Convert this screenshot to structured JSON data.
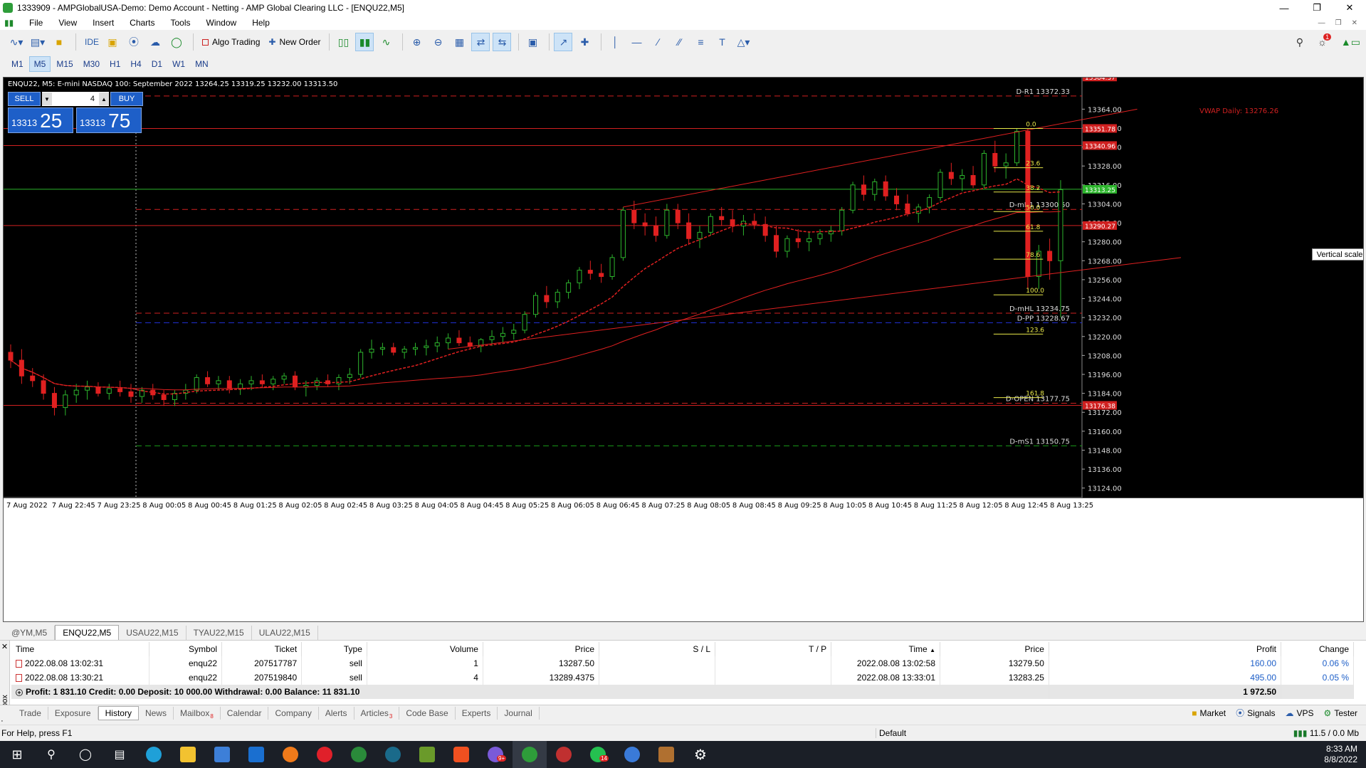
{
  "window": {
    "title": "1333909 - AMPGlobalUSA-Demo: Demo Account - Netting - AMP Global Clearing LLC - [ENQU22,M5]"
  },
  "menu": [
    "File",
    "View",
    "Insert",
    "Charts",
    "Tools",
    "Window",
    "Help"
  ],
  "toolbar": {
    "ide_label": "IDE",
    "algo_label": "Algo Trading",
    "new_order_label": "New Order",
    "notification_count": "1"
  },
  "timeframes": [
    "M1",
    "M5",
    "M15",
    "M30",
    "H1",
    "H4",
    "D1",
    "W1",
    "MN"
  ],
  "active_timeframe": "M5",
  "chart": {
    "header": "ENQU22, M5:  E-mini NASDAQ 100: September 2022   13264.25 13319.25 13232.00 13313.50",
    "sell_label": "SELL",
    "buy_label": "BUY",
    "volume": "4",
    "sell_small": "13313",
    "sell_big": "25",
    "buy_small": "13313",
    "buy_big": "75",
    "vertical_scale_tip": "Vertical scale",
    "vwap_label": "VWAP Daily: 13276.26",
    "colors": {
      "background": "#000000",
      "bull": "#2db52d",
      "bear": "#e02020",
      "level": "#d02020",
      "fib": "#e8e84a",
      "pivot_pp": "#2030d0",
      "ms1": "#1a9a1a"
    }
  },
  "chart_data": {
    "type": "candlestick",
    "symbol": "ENQU22",
    "timeframe": "M5",
    "ylim": [
      13118,
      13384
    ],
    "y_ticks": [
      13364.0,
      13352.0,
      13340.0,
      13328.0,
      13316.0,
      13304.0,
      13292.0,
      13280.0,
      13268.0,
      13256.0,
      13244.0,
      13232.0,
      13220.0,
      13208.0,
      13196.0,
      13184.0,
      13172.0,
      13160.0,
      13148.0,
      13136.0,
      13124.0
    ],
    "y_tick_labels": [
      "13364.00",
      "13352.00",
      "13340.00",
      "13328.00",
      "13316.00",
      "13304.00",
      "13292.00",
      "13280.00",
      "13268.00",
      "13256.00",
      "13244.00",
      "13232.00",
      "13220.00",
      "13208.00",
      "13196.00",
      "13184.00",
      "13172.00",
      "13160.00",
      "13148.00",
      "13136.00",
      "13124.00"
    ],
    "price_badges": [
      {
        "price": 13384.37,
        "label": "13384.37"
      },
      {
        "price": 13351.78,
        "label": "13351.78"
      },
      {
        "price": 13340.96,
        "label": "13340.96"
      },
      {
        "price": 13313.25,
        "label": "13313.25"
      },
      {
        "price": 13290.27,
        "label": "13290.27"
      },
      {
        "price": 13176.38,
        "label": "13176.38"
      }
    ],
    "x_tick_labels": [
      "7 Aug 2022",
      "7 Aug 22:45",
      "7 Aug 23:25",
      "8 Aug 00:05",
      "8 Aug 00:45",
      "8 Aug 01:25",
      "8 Aug 02:05",
      "8 Aug 02:45",
      "8 Aug 03:25",
      "8 Aug 04:05",
      "8 Aug 04:45",
      "8 Aug 05:25",
      "8 Aug 06:05",
      "8 Aug 06:45",
      "8 Aug 07:25",
      "8 Aug 08:05",
      "8 Aug 08:45",
      "8 Aug 09:25",
      "8 Aug 10:05",
      "8 Aug 10:45",
      "8 Aug 11:25",
      "8 Aug 12:05",
      "8 Aug 12:45",
      "8 Aug 13:25"
    ],
    "levels": [
      {
        "name": "D-R1",
        "price": 13372.33,
        "label": "D-R1 13372.33",
        "style": "dash"
      },
      {
        "name": "D-mR1",
        "price": 13300.5,
        "label": "D-mR1 13300.50",
        "style": "dash"
      },
      {
        "name": "D-mHL",
        "price": 13234.75,
        "label": "D-mHL 13234.75",
        "style": "dash"
      },
      {
        "name": "D-PP",
        "price": 13228.67,
        "label": "D-PP 13228.67",
        "style": "dash"
      },
      {
        "name": "D-OPEN",
        "price": 13177.75,
        "label": "D-OPEN 13177.75",
        "style": "dash"
      },
      {
        "name": "D-mS1",
        "price": 13150.75,
        "label": "D-mS1 13150.75",
        "style": "dash"
      }
    ],
    "fibonacci": [
      {
        "level": "0.0",
        "price": 13351.78
      },
      {
        "level": "23.6",
        "price": 13326.9
      },
      {
        "level": "38.2",
        "price": 13311.5
      },
      {
        "level": "50.0",
        "price": 13299.1
      },
      {
        "level": "61.8",
        "price": 13286.7
      },
      {
        "level": "78.6",
        "price": 13269.0
      },
      {
        "level": "100.0",
        "price": 13246.4
      },
      {
        "level": "123.6",
        "price": 13221.5
      },
      {
        "level": "161.8",
        "price": 13181.3
      }
    ],
    "candles": [
      [
        13210,
        13215,
        13200,
        13205
      ],
      [
        13205,
        13212,
        13190,
        13195
      ],
      [
        13195,
        13200,
        13188,
        13192
      ],
      [
        13192,
        13196,
        13180,
        13184
      ],
      [
        13184,
        13188,
        13170,
        13175
      ],
      [
        13175,
        13186,
        13170,
        13183
      ],
      [
        13183,
        13190,
        13178,
        13186
      ],
      [
        13186,
        13192,
        13180,
        13188
      ],
      [
        13188,
        13191,
        13182,
        13184
      ],
      [
        13184,
        13190,
        13180,
        13187
      ],
      [
        13187,
        13192,
        13182,
        13185
      ],
      [
        13185,
        13190,
        13178,
        13182
      ],
      [
        13182,
        13188,
        13178,
        13186
      ],
      [
        13186,
        13190,
        13180,
        13183
      ],
      [
        13183,
        13186,
        13176,
        13180
      ],
      [
        13180,
        13186,
        13176,
        13184
      ],
      [
        13184,
        13190,
        13180,
        13186
      ],
      [
        13186,
        13196,
        13184,
        13194
      ],
      [
        13194,
        13198,
        13188,
        13190
      ],
      [
        13190,
        13195,
        13186,
        13192
      ],
      [
        13192,
        13195,
        13184,
        13187
      ],
      [
        13187,
        13193,
        13183,
        13190
      ],
      [
        13190,
        13195,
        13186,
        13192
      ],
      [
        13192,
        13196,
        13188,
        13190
      ],
      [
        13190,
        13195,
        13186,
        13193
      ],
      [
        13193,
        13197,
        13190,
        13195
      ],
      [
        13195,
        13198,
        13186,
        13188
      ],
      [
        13188,
        13192,
        13182,
        13189
      ],
      [
        13189,
        13194,
        13186,
        13192
      ],
      [
        13192,
        13196,
        13188,
        13190
      ],
      [
        13190,
        13196,
        13186,
        13194
      ],
      [
        13194,
        13200,
        13190,
        13196
      ],
      [
        13196,
        13212,
        13194,
        13210
      ],
      [
        13210,
        13218,
        13206,
        13212
      ],
      [
        13212,
        13216,
        13208,
        13213
      ],
      [
        13213,
        13216,
        13208,
        13210
      ],
      [
        13210,
        13214,
        13206,
        13212
      ],
      [
        13212,
        13216,
        13208,
        13213
      ],
      [
        13213,
        13218,
        13208,
        13214
      ],
      [
        13214,
        13220,
        13210,
        13216
      ],
      [
        13216,
        13222,
        13212,
        13219
      ],
      [
        13219,
        13224,
        13214,
        13216
      ],
      [
        13216,
        13220,
        13212,
        13214
      ],
      [
        13214,
        13219,
        13210,
        13218
      ],
      [
        13218,
        13224,
        13214,
        13220
      ],
      [
        13220,
        13226,
        13216,
        13222
      ],
      [
        13222,
        13228,
        13218,
        13224
      ],
      [
        13224,
        13236,
        13222,
        13234
      ],
      [
        13234,
        13248,
        13232,
        13246
      ],
      [
        13246,
        13252,
        13238,
        13242
      ],
      [
        13242,
        13250,
        13238,
        13248
      ],
      [
        13248,
        13256,
        13244,
        13254
      ],
      [
        13254,
        13264,
        13250,
        13262
      ],
      [
        13262,
        13268,
        13256,
        13260
      ],
      [
        13260,
        13266,
        13254,
        13258
      ],
      [
        13258,
        13272,
        13256,
        13270
      ],
      [
        13270,
        13302,
        13268,
        13300
      ],
      [
        13300,
        13306,
        13288,
        13292
      ],
      [
        13292,
        13298,
        13284,
        13290
      ],
      [
        13290,
        13296,
        13280,
        13284
      ],
      [
        13284,
        13304,
        13282,
        13300
      ],
      [
        13300,
        13304,
        13288,
        13292
      ],
      [
        13292,
        13298,
        13278,
        13282
      ],
      [
        13282,
        13290,
        13276,
        13286
      ],
      [
        13286,
        13298,
        13284,
        13296
      ],
      [
        13296,
        13302,
        13290,
        13294
      ],
      [
        13294,
        13300,
        13286,
        13290
      ],
      [
        13290,
        13297,
        13284,
        13293
      ],
      [
        13293,
        13298,
        13288,
        13291
      ],
      [
        13291,
        13296,
        13280,
        13284
      ],
      [
        13284,
        13290,
        13270,
        13274
      ],
      [
        13274,
        13284,
        13270,
        13282
      ],
      [
        13282,
        13288,
        13276,
        13280
      ],
      [
        13280,
        13286,
        13274,
        13282
      ],
      [
        13282,
        13288,
        13278,
        13285
      ],
      [
        13285,
        13290,
        13280,
        13287
      ],
      [
        13287,
        13302,
        13284,
        13300
      ],
      [
        13300,
        13318,
        13298,
        13316
      ],
      [
        13316,
        13322,
        13306,
        13310
      ],
      [
        13310,
        13320,
        13306,
        13318
      ],
      [
        13318,
        13322,
        13306,
        13309
      ],
      [
        13309,
        13314,
        13300,
        13304
      ],
      [
        13304,
        13310,
        13296,
        13298
      ],
      [
        13298,
        13304,
        13292,
        13302
      ],
      [
        13302,
        13310,
        13298,
        13308
      ],
      [
        13308,
        13326,
        13306,
        13324
      ],
      [
        13324,
        13330,
        13316,
        13320
      ],
      [
        13320,
        13326,
        13312,
        13322
      ],
      [
        13322,
        13328,
        13314,
        13316
      ],
      [
        13316,
        13338,
        13314,
        13336
      ],
      [
        13336,
        13344,
        13324,
        13328
      ],
      [
        13328,
        13336,
        13320,
        13330
      ],
      [
        13330,
        13352,
        13328,
        13350
      ],
      [
        13350,
        13352,
        13250,
        13258
      ],
      [
        13258,
        13278,
        13250,
        13274
      ],
      [
        13274,
        13282,
        13256,
        13268
      ],
      [
        13268,
        13319,
        13232,
        13313
      ]
    ]
  },
  "symbol_tabs": [
    "@YM,M5",
    "ENQU22,M5",
    "USAU22,M15",
    "TYAU22,M15",
    "ULAU22,M15"
  ],
  "active_symbol_tab": "ENQU22,M5",
  "history": {
    "columns": [
      "Time",
      "Symbol",
      "Ticket",
      "Type",
      "Volume",
      "Price",
      "S / L",
      "T / P",
      "Time",
      "Price",
      "Profit",
      "Change"
    ],
    "rows": [
      {
        "open_time": "2022.08.08 13:02:31",
        "symbol": "enqu22",
        "ticket": "207517787",
        "type": "sell",
        "volume": "1",
        "price": "13287.50",
        "sl": "",
        "tp": "",
        "close_time": "2022.08.08 13:02:58",
        "close_price": "13279.50",
        "profit": "160.00",
        "change": "0.06 %"
      },
      {
        "open_time": "2022.08.08 13:30:21",
        "symbol": "enqu22",
        "ticket": "207519840",
        "type": "sell",
        "volume": "4",
        "price": "13289.4375",
        "sl": "",
        "tp": "",
        "close_time": "2022.08.08 13:33:01",
        "close_price": "13283.25",
        "profit": "495.00",
        "change": "0.05 %"
      }
    ],
    "summary": "Profit: 1 831.10  Credit: 0.00  Deposit: 10 000.00  Withdrawal: 0.00  Balance: 11 831.10",
    "summary_profit": "1 972.50"
  },
  "toolbox_label": "Toolbox",
  "bottom_tabs": [
    {
      "label": "Trade",
      "badge": ""
    },
    {
      "label": "Exposure",
      "badge": ""
    },
    {
      "label": "History",
      "badge": ""
    },
    {
      "label": "News",
      "badge": ""
    },
    {
      "label": "Mailbox",
      "badge": "8"
    },
    {
      "label": "Calendar",
      "badge": ""
    },
    {
      "label": "Company",
      "badge": ""
    },
    {
      "label": "Alerts",
      "badge": ""
    },
    {
      "label": "Articles",
      "badge": "3"
    },
    {
      "label": "Code Base",
      "badge": ""
    },
    {
      "label": "Experts",
      "badge": ""
    },
    {
      "label": "Journal",
      "badge": ""
    }
  ],
  "active_bottom_tab": "History",
  "bottom_right": [
    "Market",
    "Signals",
    "VPS",
    "Tester"
  ],
  "status": {
    "help": "For Help, press F1",
    "profile": "Default",
    "traffic": "11.5 / 0.0 Mb"
  },
  "taskbar": {
    "time": "8:33 AM",
    "date": "8/8/2022",
    "badges": {
      "chat": "9+",
      "whatsapp": "14"
    }
  }
}
